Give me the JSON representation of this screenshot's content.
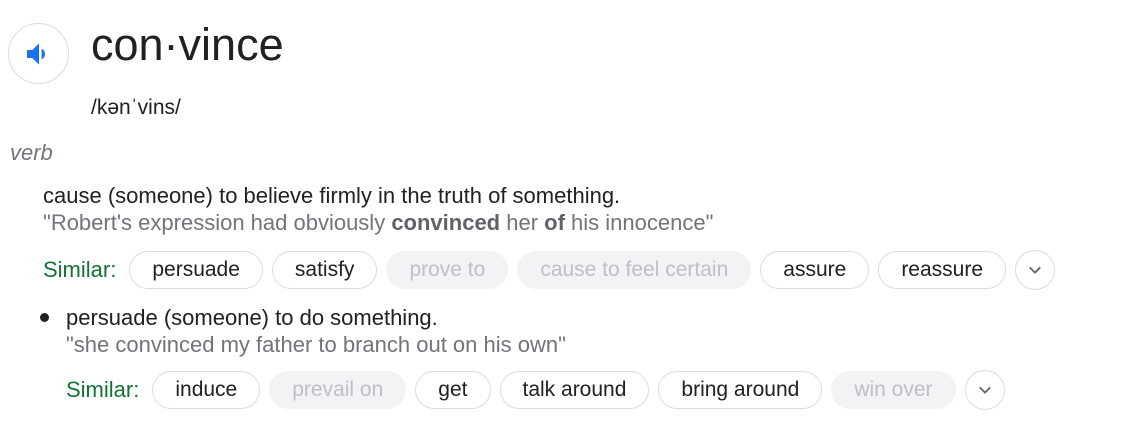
{
  "entry": {
    "word": "con·vince",
    "phonetic": "/kənˈvins/",
    "part_of_speech": "verb",
    "speaker_icon": "volume-up-icon",
    "speaker_color": "#1a73e8"
  },
  "senses": [
    {
      "definition": "cause (someone) to believe firmly in the truth of something.",
      "example": {
        "open_quote": "\"",
        "part1": "Robert's expression had obviously ",
        "bold1": "convinced",
        "part2": " her ",
        "bold2": "of",
        "part3": " his innocence",
        "close_quote": "\""
      },
      "similar_label": "Similar:",
      "similar": [
        {
          "label": "persuade",
          "enabled": true
        },
        {
          "label": "satisfy",
          "enabled": true
        },
        {
          "label": "prove to",
          "enabled": false
        },
        {
          "label": "cause to feel certain",
          "enabled": false
        },
        {
          "label": "assure",
          "enabled": true
        },
        {
          "label": "reassure",
          "enabled": true
        }
      ]
    },
    {
      "definition": "persuade (someone) to do something.",
      "example": "\"she convinced my father to branch out on his own\"",
      "similar_label": "Similar:",
      "similar": [
        {
          "label": "induce",
          "enabled": true
        },
        {
          "label": "prevail on",
          "enabled": false
        },
        {
          "label": "get",
          "enabled": true
        },
        {
          "label": "talk around",
          "enabled": true
        },
        {
          "label": "bring around",
          "enabled": true
        },
        {
          "label": "win over",
          "enabled": false
        }
      ]
    }
  ],
  "colors": {
    "similar_label": "#137333",
    "chip_disabled_bg": "#f1f3f4",
    "chip_disabled_text": "#bdc1c6",
    "example_text": "#70757a"
  }
}
